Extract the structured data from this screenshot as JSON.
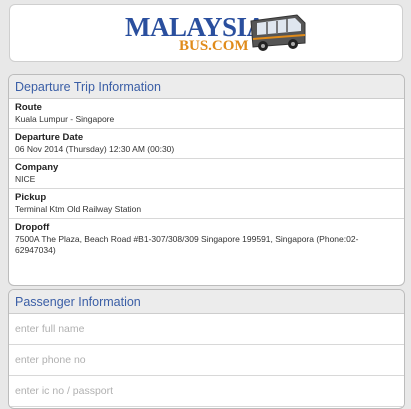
{
  "logo": {
    "main": "MALAYSIA",
    "sub": "BUS.COM",
    "icon": "bus-icon"
  },
  "departure": {
    "title": "Departure Trip Information",
    "fields": [
      {
        "label": "Route",
        "value": "Kuala Lumpur - Singapore"
      },
      {
        "label": "Departure Date",
        "value": "06 Nov 2014 (Thursday) 12:30 AM (00:30)"
      },
      {
        "label": "Company",
        "value": "NICE"
      },
      {
        "label": "Pickup",
        "value": "Terminal Ktm Old Railway Station"
      },
      {
        "label": "Dropoff",
        "value": "7500A The Plaza, Beach Road #B1-307/308/309 Singapore 199591, Singapora (Phone:02-62947034)"
      }
    ]
  },
  "passenger": {
    "title": "Passenger Information",
    "name_placeholder": "enter full name",
    "phone_placeholder": "enter phone no",
    "ic_placeholder": "enter ic no / passport"
  },
  "colors": {
    "brand_blue": "#2a4f9e",
    "brand_orange": "#e08b1a",
    "title_blue": "#3a5ea6"
  }
}
